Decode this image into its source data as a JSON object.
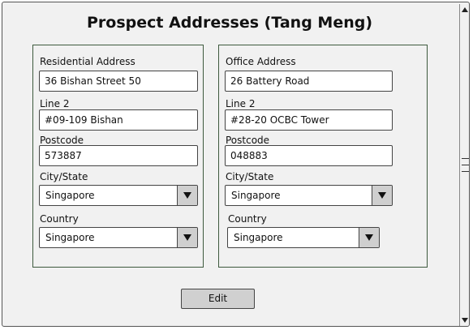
{
  "title": "Prospect Addresses (Tang Meng)",
  "residential": {
    "address_label": "Residential Address",
    "address_value": "36 Bishan Street 50",
    "line2_label": "Line 2",
    "line2_value": "#09-109 Bishan",
    "postcode_label": "Postcode",
    "postcode_value": "573887",
    "city_label": "City/State",
    "city_value": "Singapore",
    "country_label": "Country",
    "country_value": "Singapore"
  },
  "office": {
    "address_label": "Office Address",
    "address_value": "26 Battery Road",
    "line2_label": "Line 2",
    "line2_value": "#28-20 OCBC Tower",
    "postcode_label": "Postcode",
    "postcode_value": "048883",
    "city_label": "City/State",
    "city_value": "Singapore",
    "country_label": "Country",
    "country_value": "Singapore"
  },
  "edit_label": "Edit"
}
